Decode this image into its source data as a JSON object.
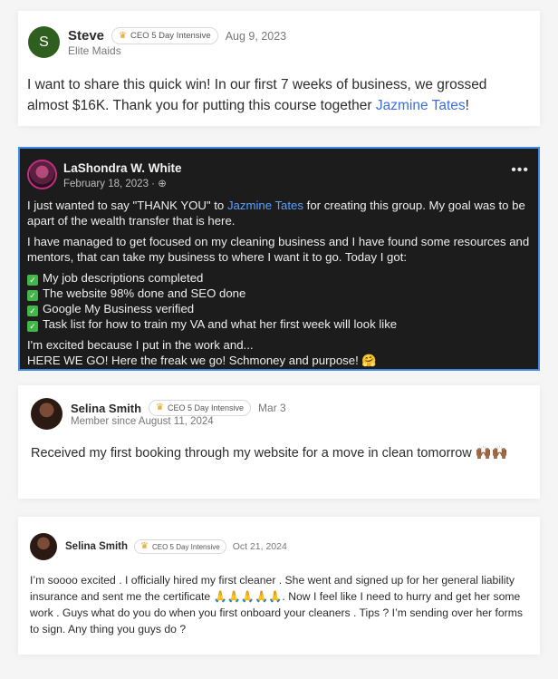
{
  "posts": [
    {
      "author": "Steve",
      "avatar_initial": "S",
      "badge": "CEO 5 Day Intensive",
      "date": "Aug 9, 2023",
      "subtitle": "Elite Maids",
      "text_before": "I want to share this quick win! In our first 7 weeks of business, we grossed almost $16K. Thank you for putting this course together ",
      "mention": "Jazmine Tates",
      "text_after": "!"
    },
    {
      "author": "LaShondra W. White",
      "date": "February 18, 2023 · ⊕",
      "menu_icon": "•••",
      "p1_before": "I just wanted to say \"THANK YOU\" to ",
      "p1_mention": "Jazmine Tates",
      "p1_after": " for creating this group. My goal was to be apart of the wealth transfer that is here.",
      "p2": "I have managed to get focused on my cleaning business and I have found some resources and mentors, that can take my business to where I want it to go. Today I got:",
      "checklist": [
        "My job descriptions completed",
        "The website 98% done and SEO done",
        "Google My Business verified",
        "Task list for how to train my VA and what her first week will look like"
      ],
      "p3_line1": "I'm excited because I put in the work and...",
      "p3_line2": "HERE WE GO! Here the freak we go! Schmoney and purpose! 🤗"
    },
    {
      "author": "Selina Smith",
      "badge": "CEO 5 Day Intensive",
      "date": "Mar 3",
      "subtitle": "Member since August 11, 2024",
      "text": "Received my first booking through my website for a move in clean tomorrow 🙌🏾🙌🏾"
    },
    {
      "author": "Selina Smith",
      "badge": "CEO 5 Day Intensive",
      "date": "Oct 21, 2024",
      "text": "I’m soooo excited . I officially hired my first cleaner . She went and signed up for her general liability insurance and sent me the certificate 🙏🙏🙏🙏🙏. Now I feel like I need to hurry and get her some work . Guys what do you do when you first onboard your cleaners . Tips ? I’m sending over her forms to sign. Any thing you guys do ?"
    }
  ],
  "colors": {
    "mention": "#3d6fdc",
    "dark_card_bg": "#1c1c1d",
    "dark_card_border": "#3f88e6",
    "check_green": "#43b649"
  }
}
